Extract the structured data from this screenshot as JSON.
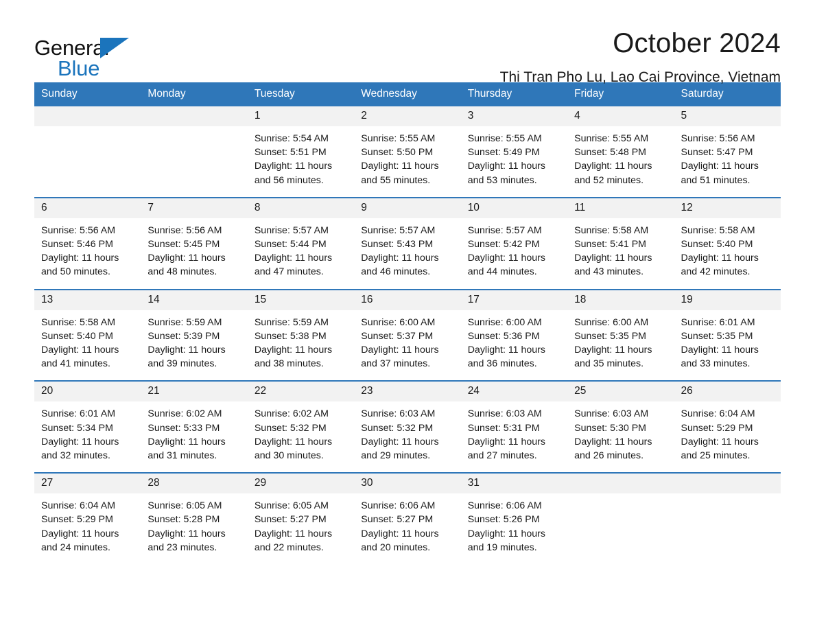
{
  "brand": {
    "name_part1": "General",
    "name_part2": "Blue",
    "accent_color": "#1b74bc"
  },
  "header": {
    "title": "October 2024",
    "subtitle": "Thi Tran Pho Lu, Lao Cai Province, Vietnam"
  },
  "calendar": {
    "header_bg": "#2f77b9",
    "daynum_bg": "#f2f2f2",
    "weekday_headers": [
      "Sunday",
      "Monday",
      "Tuesday",
      "Wednesday",
      "Thursday",
      "Friday",
      "Saturday"
    ],
    "weeks": [
      [
        {
          "day": "",
          "lines": []
        },
        {
          "day": "",
          "lines": []
        },
        {
          "day": "1",
          "lines": [
            "Sunrise: 5:54 AM",
            "Sunset: 5:51 PM",
            "Daylight: 11 hours",
            "and 56 minutes."
          ]
        },
        {
          "day": "2",
          "lines": [
            "Sunrise: 5:55 AM",
            "Sunset: 5:50 PM",
            "Daylight: 11 hours",
            "and 55 minutes."
          ]
        },
        {
          "day": "3",
          "lines": [
            "Sunrise: 5:55 AM",
            "Sunset: 5:49 PM",
            "Daylight: 11 hours",
            "and 53 minutes."
          ]
        },
        {
          "day": "4",
          "lines": [
            "Sunrise: 5:55 AM",
            "Sunset: 5:48 PM",
            "Daylight: 11 hours",
            "and 52 minutes."
          ]
        },
        {
          "day": "5",
          "lines": [
            "Sunrise: 5:56 AM",
            "Sunset: 5:47 PM",
            "Daylight: 11 hours",
            "and 51 minutes."
          ]
        }
      ],
      [
        {
          "day": "6",
          "lines": [
            "Sunrise: 5:56 AM",
            "Sunset: 5:46 PM",
            "Daylight: 11 hours",
            "and 50 minutes."
          ]
        },
        {
          "day": "7",
          "lines": [
            "Sunrise: 5:56 AM",
            "Sunset: 5:45 PM",
            "Daylight: 11 hours",
            "and 48 minutes."
          ]
        },
        {
          "day": "8",
          "lines": [
            "Sunrise: 5:57 AM",
            "Sunset: 5:44 PM",
            "Daylight: 11 hours",
            "and 47 minutes."
          ]
        },
        {
          "day": "9",
          "lines": [
            "Sunrise: 5:57 AM",
            "Sunset: 5:43 PM",
            "Daylight: 11 hours",
            "and 46 minutes."
          ]
        },
        {
          "day": "10",
          "lines": [
            "Sunrise: 5:57 AM",
            "Sunset: 5:42 PM",
            "Daylight: 11 hours",
            "and 44 minutes."
          ]
        },
        {
          "day": "11",
          "lines": [
            "Sunrise: 5:58 AM",
            "Sunset: 5:41 PM",
            "Daylight: 11 hours",
            "and 43 minutes."
          ]
        },
        {
          "day": "12",
          "lines": [
            "Sunrise: 5:58 AM",
            "Sunset: 5:40 PM",
            "Daylight: 11 hours",
            "and 42 minutes."
          ]
        }
      ],
      [
        {
          "day": "13",
          "lines": [
            "Sunrise: 5:58 AM",
            "Sunset: 5:40 PM",
            "Daylight: 11 hours",
            "and 41 minutes."
          ]
        },
        {
          "day": "14",
          "lines": [
            "Sunrise: 5:59 AM",
            "Sunset: 5:39 PM",
            "Daylight: 11 hours",
            "and 39 minutes."
          ]
        },
        {
          "day": "15",
          "lines": [
            "Sunrise: 5:59 AM",
            "Sunset: 5:38 PM",
            "Daylight: 11 hours",
            "and 38 minutes."
          ]
        },
        {
          "day": "16",
          "lines": [
            "Sunrise: 6:00 AM",
            "Sunset: 5:37 PM",
            "Daylight: 11 hours",
            "and 37 minutes."
          ]
        },
        {
          "day": "17",
          "lines": [
            "Sunrise: 6:00 AM",
            "Sunset: 5:36 PM",
            "Daylight: 11 hours",
            "and 36 minutes."
          ]
        },
        {
          "day": "18",
          "lines": [
            "Sunrise: 6:00 AM",
            "Sunset: 5:35 PM",
            "Daylight: 11 hours",
            "and 35 minutes."
          ]
        },
        {
          "day": "19",
          "lines": [
            "Sunrise: 6:01 AM",
            "Sunset: 5:35 PM",
            "Daylight: 11 hours",
            "and 33 minutes."
          ]
        }
      ],
      [
        {
          "day": "20",
          "lines": [
            "Sunrise: 6:01 AM",
            "Sunset: 5:34 PM",
            "Daylight: 11 hours",
            "and 32 minutes."
          ]
        },
        {
          "day": "21",
          "lines": [
            "Sunrise: 6:02 AM",
            "Sunset: 5:33 PM",
            "Daylight: 11 hours",
            "and 31 minutes."
          ]
        },
        {
          "day": "22",
          "lines": [
            "Sunrise: 6:02 AM",
            "Sunset: 5:32 PM",
            "Daylight: 11 hours",
            "and 30 minutes."
          ]
        },
        {
          "day": "23",
          "lines": [
            "Sunrise: 6:03 AM",
            "Sunset: 5:32 PM",
            "Daylight: 11 hours",
            "and 29 minutes."
          ]
        },
        {
          "day": "24",
          "lines": [
            "Sunrise: 6:03 AM",
            "Sunset: 5:31 PM",
            "Daylight: 11 hours",
            "and 27 minutes."
          ]
        },
        {
          "day": "25",
          "lines": [
            "Sunrise: 6:03 AM",
            "Sunset: 5:30 PM",
            "Daylight: 11 hours",
            "and 26 minutes."
          ]
        },
        {
          "day": "26",
          "lines": [
            "Sunrise: 6:04 AM",
            "Sunset: 5:29 PM",
            "Daylight: 11 hours",
            "and 25 minutes."
          ]
        }
      ],
      [
        {
          "day": "27",
          "lines": [
            "Sunrise: 6:04 AM",
            "Sunset: 5:29 PM",
            "Daylight: 11 hours",
            "and 24 minutes."
          ]
        },
        {
          "day": "28",
          "lines": [
            "Sunrise: 6:05 AM",
            "Sunset: 5:28 PM",
            "Daylight: 11 hours",
            "and 23 minutes."
          ]
        },
        {
          "day": "29",
          "lines": [
            "Sunrise: 6:05 AM",
            "Sunset: 5:27 PM",
            "Daylight: 11 hours",
            "and 22 minutes."
          ]
        },
        {
          "day": "30",
          "lines": [
            "Sunrise: 6:06 AM",
            "Sunset: 5:27 PM",
            "Daylight: 11 hours",
            "and 20 minutes."
          ]
        },
        {
          "day": "31",
          "lines": [
            "Sunrise: 6:06 AM",
            "Sunset: 5:26 PM",
            "Daylight: 11 hours",
            "and 19 minutes."
          ]
        },
        {
          "day": "",
          "lines": []
        },
        {
          "day": "",
          "lines": []
        }
      ]
    ]
  }
}
